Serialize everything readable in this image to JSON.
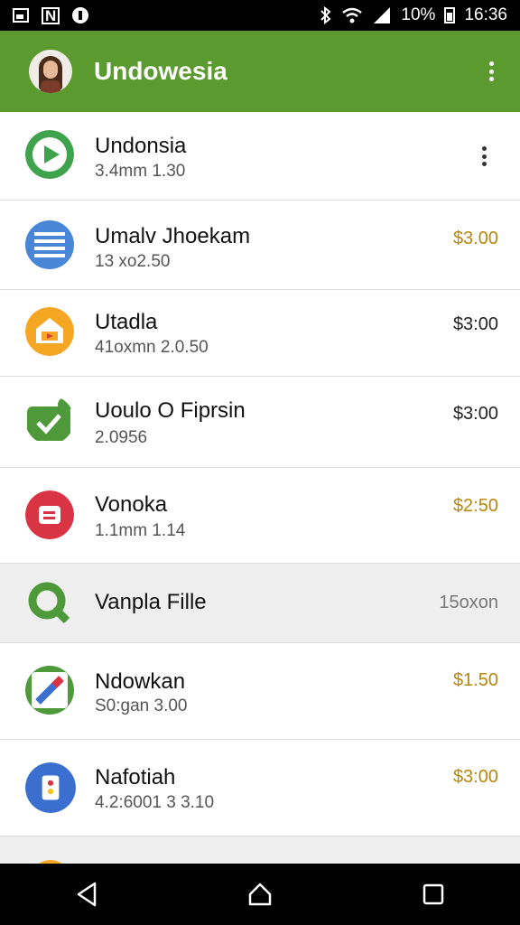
{
  "status_bar": {
    "battery_text": "10%",
    "time": "16:36"
  },
  "app_bar": {
    "title": "Undowesia"
  },
  "items": [
    {
      "title": "Undonsia",
      "subtitle": "3.4mm 1.30",
      "price": "",
      "icon": "play-icon",
      "color": "#3fa34d"
    },
    {
      "title": "Umalv Jhoekam",
      "subtitle": "13 xo2.50",
      "price": "$3.00",
      "icon": "document-icon",
      "color": "#4a86d8"
    },
    {
      "title": "Utadla",
      "subtitle": "41oxmn 2.0.50",
      "price": "$3:00",
      "icon": "home-icon",
      "color": "#f5a623"
    },
    {
      "title": "Uoulo O Fiprsin",
      "subtitle": "2.0956",
      "price": "$3:00",
      "icon": "check-icon",
      "color": "#4e9a3a"
    },
    {
      "title": "Vonoka",
      "subtitle": "1.1mm 1.14",
      "price": "$2:50",
      "icon": "chat-icon",
      "color": "#d93444"
    },
    {
      "title": "Vanpla Fille",
      "subtitle": "",
      "price": "15oxon",
      "icon": "search-icon",
      "color": "#4e9a3a"
    },
    {
      "title": "Ndowkan",
      "subtitle": "S0:gan 3.00",
      "price": "$1.50",
      "icon": "pencil-icon",
      "color": "#4e9a3a"
    },
    {
      "title": "Nafotiah",
      "subtitle": "4.2:6001 3 3.10",
      "price": "$3:00",
      "icon": "badge-icon",
      "color": "#3a6fd0"
    }
  ]
}
